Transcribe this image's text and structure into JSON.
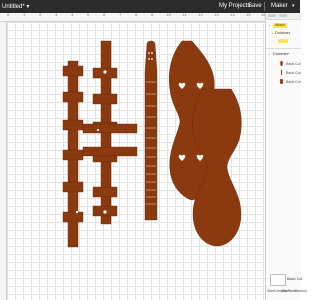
{
  "header": {
    "title": "Untitled*",
    "dropdown_glyph": "▾",
    "my_projects_label": "My Projects",
    "save_label": "Save",
    "machine_label": "Maker",
    "machine_dropdown_glyph": "▾"
  },
  "ruler": {
    "ticks": [
      "0",
      "1",
      "2",
      "3",
      "4",
      "5",
      "6",
      "7",
      "8",
      "9",
      "10",
      "11",
      "12",
      "13",
      "14",
      "15",
      "16"
    ]
  },
  "layers_panel": {
    "attach_label": "Attach",
    "groups": [
      {
        "label": "Dulcimer",
        "expanded": true,
        "tag": "",
        "layers": []
      },
      {
        "label": "Dulcimer*",
        "expanded": true,
        "layers": [
          {
            "label": "Basic Cut",
            "icon": "peghead-shape-icon"
          },
          {
            "label": "Basic Cut",
            "icon": "fretboard-shape-icon"
          },
          {
            "label": "Basic Cut",
            "icon": "body-shape-icon"
          }
        ]
      }
    ],
    "blank_canvas_label": "Basic Cut",
    "actions": [
      "Slice",
      "Combine",
      "Attach",
      "Flatten",
      "Contour"
    ]
  },
  "colors": {
    "wood": "#8B3A0F",
    "topbar": "#2b2b2b",
    "highlight": "#ffe34d"
  }
}
